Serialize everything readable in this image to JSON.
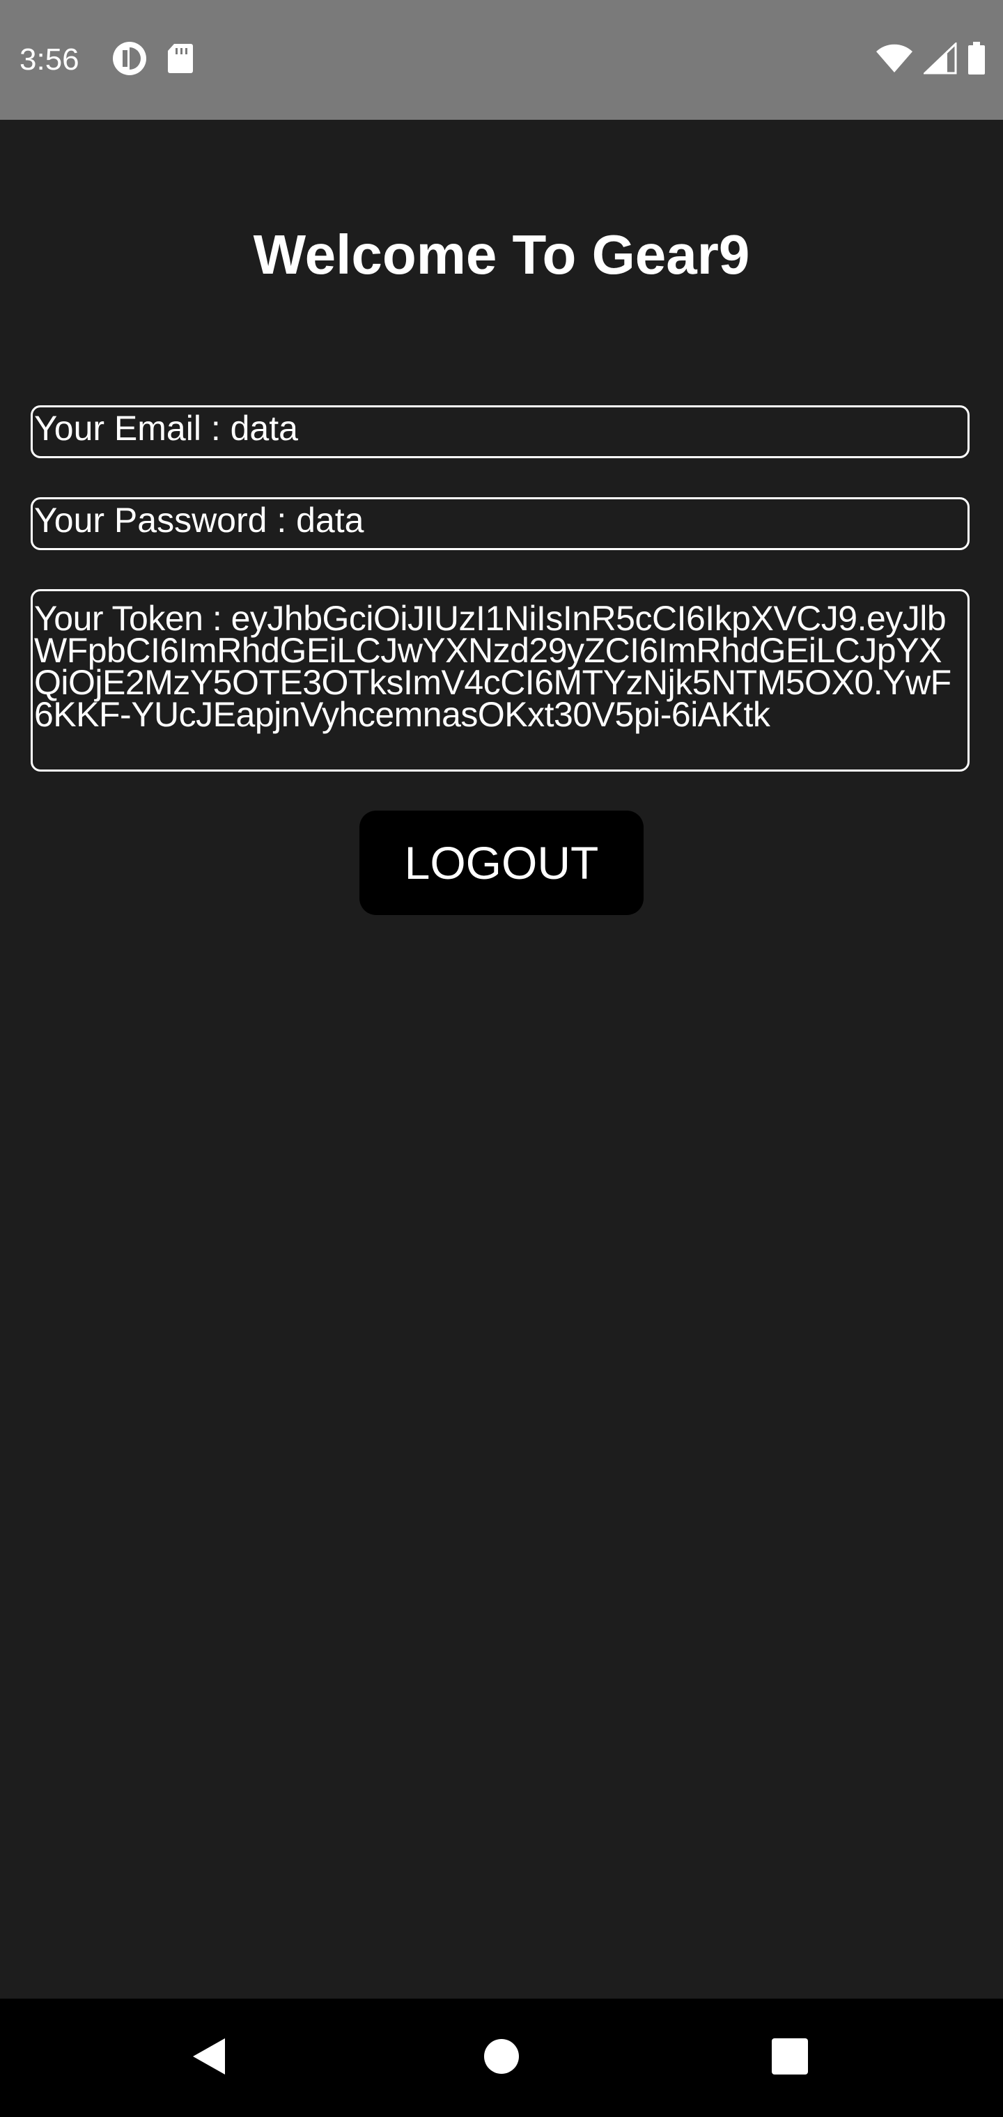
{
  "status_bar": {
    "time": "3:56",
    "icons": [
      "data-saver-icon",
      "sd-card-icon",
      "wifi-icon",
      "cell-signal-icon",
      "battery-icon"
    ]
  },
  "app": {
    "title": "Welcome To Gear9",
    "email_text": "Your Email : data",
    "password_text": "Your Password : data",
    "token_text": "Your Token : eyJhbGciOiJIUzI1NiIsInR5cCI6IkpXVCJ9.eyJlbWFpbCI6ImRhdGEiLCJwYXNzd29yZCI6ImRhdGEiLCJpYXQiOjE2MzY5OTE3OTksImV4cCI6MTYzNjk5NTM5OX0.YwF6KKF-YUcJEapjnVyhcemnasOKxt30V5pi-6iAKtk",
    "logout_label": "LOGOUT"
  },
  "nav_bar": {
    "icons": [
      "back-icon",
      "home-icon",
      "recents-icon"
    ]
  },
  "colors": {
    "background": "#1d1d1d",
    "status_bar": "#7a7a7a",
    "button": "#000000",
    "text": "#ffffff"
  }
}
